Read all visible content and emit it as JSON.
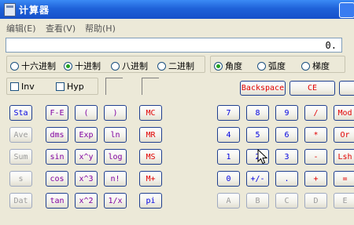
{
  "window": {
    "title": "计算器"
  },
  "menu": [
    "编辑(E)",
    "查看(V)",
    "帮助(H)"
  ],
  "display": {
    "value": "0."
  },
  "base_options": [
    {
      "label": "十六进制",
      "selected": false
    },
    {
      "label": "十进制",
      "selected": true
    },
    {
      "label": "八进制",
      "selected": false
    },
    {
      "label": "二进制",
      "selected": false
    }
  ],
  "angle_options": [
    {
      "label": "角度",
      "selected": true
    },
    {
      "label": "弧度",
      "selected": false
    },
    {
      "label": "梯度",
      "selected": false
    }
  ],
  "checks": {
    "inv": "Inv",
    "hyp": "Hyp"
  },
  "top_buttons": {
    "backspace": "Backspace",
    "ce": "CE"
  },
  "stat_buttons": [
    "Sta",
    "Ave",
    "Sum",
    "s",
    "Dat"
  ],
  "func_buttons": [
    [
      "F-E",
      "(",
      ")"
    ],
    [
      "dms",
      "Exp",
      "ln"
    ],
    [
      "sin",
      "x^y",
      "log"
    ],
    [
      "cos",
      "x^3",
      "n!"
    ],
    [
      "tan",
      "x^2",
      "1/x"
    ]
  ],
  "memory_buttons": [
    "MC",
    "MR",
    "MS",
    "M+",
    "pi"
  ],
  "keypad": [
    [
      "7",
      "8",
      "9",
      "/",
      "Mod"
    ],
    [
      "4",
      "5",
      "6",
      "*",
      "Or"
    ],
    [
      "1",
      "2",
      "3",
      "-",
      "Lsh"
    ],
    [
      "0",
      "+/-",
      ".",
      "+",
      "="
    ],
    [
      "A",
      "B",
      "C",
      "D",
      "E"
    ]
  ],
  "colors": {
    "title_blue": "#1f62d9",
    "red": "#e00000",
    "blue": "#0000e0",
    "disabled": "#9b9b9b"
  }
}
